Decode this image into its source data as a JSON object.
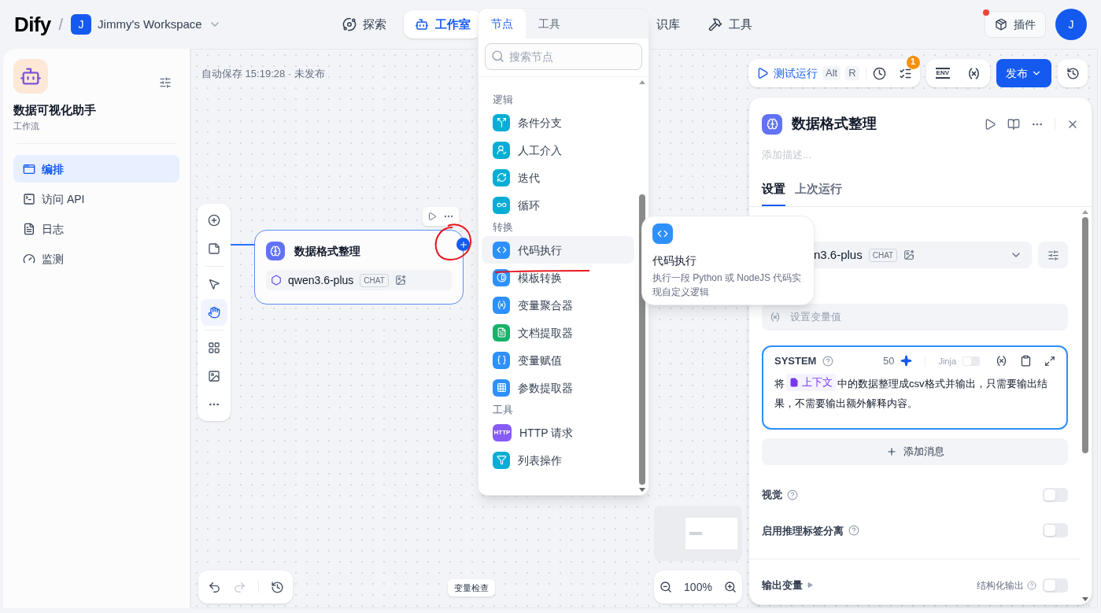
{
  "header": {
    "logo": "Dify",
    "separator": "/",
    "workspace": {
      "initial": "J",
      "name": "Jimmy's Workspace"
    },
    "nav": [
      {
        "label": "探索",
        "selected": false
      },
      {
        "label": "工作室",
        "selected": true
      },
      {
        "label": "识库",
        "selected": false
      },
      {
        "label": "工具",
        "selected": false
      }
    ],
    "plugins": {
      "label": "插件",
      "notification": true
    },
    "avatar": "J"
  },
  "sidebar": {
    "app_name": "数据可视化助手",
    "app_type": "工作流",
    "items": [
      {
        "label": "编排",
        "selected": true
      },
      {
        "label": "访问 API",
        "selected": false
      },
      {
        "label": "日志",
        "selected": false
      },
      {
        "label": "监测",
        "selected": false
      }
    ]
  },
  "canvas": {
    "autosave": "自动保存 15:19:28 · 未发布",
    "node": {
      "title": "数据格式整理",
      "model": "qwen3.6-plus",
      "model_tag": "CHAT"
    },
    "variable_inspect": "变量检查",
    "zoom": "100%"
  },
  "toolbar": {
    "test_run": "测试运行",
    "shortcut_keys": [
      "Alt",
      "R"
    ],
    "checklist_count": "1",
    "env": "ENV",
    "publish": "发布"
  },
  "node_menu": {
    "tabs": [
      {
        "label": "节点",
        "selected": true
      },
      {
        "label": "工具",
        "selected": false
      }
    ],
    "search_placeholder": "搜索节点",
    "groups": [
      {
        "title": "逻辑",
        "items": [
          {
            "label": "条件分支",
            "color": "#06aed4",
            "selected": false
          },
          {
            "label": "人工介入",
            "color": "#06aed4",
            "selected": false
          },
          {
            "label": "迭代",
            "color": "#06aed4",
            "selected": false
          },
          {
            "label": "循环",
            "color": "#06aed4",
            "selected": false
          }
        ]
      },
      {
        "title": "转换",
        "items": [
          {
            "label": "代码执行",
            "color": "#2e90fa",
            "selected": true
          },
          {
            "label": "模板转换",
            "color": "#2e90fa",
            "selected": false
          },
          {
            "label": "变量聚合器",
            "color": "#2e90fa",
            "selected": false
          },
          {
            "label": "文档提取器",
            "color": "#17b26a",
            "selected": false
          },
          {
            "label": "变量赋值",
            "color": "#2e90fa",
            "selected": false
          },
          {
            "label": "参数提取器",
            "color": "#2e90fa",
            "selected": false
          }
        ]
      },
      {
        "title": "工具",
        "items": [
          {
            "label": "HTTP 请求",
            "badge": "HTTP",
            "color": "#875bf7",
            "selected": false
          },
          {
            "label": "列表操作",
            "color": "#06aed4",
            "selected": false
          }
        ]
      }
    ]
  },
  "tooltip": {
    "title": "代码执行",
    "description": "执行一段 Python 或 NodeJS 代码实现自定义逻辑"
  },
  "panel": {
    "title": "数据格式整理",
    "description_placeholder": "添加描述...",
    "tabs": [
      {
        "label": "设置",
        "selected": true
      },
      {
        "label": "上次运行",
        "selected": false
      }
    ],
    "model": "n3.6-plus",
    "model_tag": "CHAT",
    "variable_placeholder": "设置变量值",
    "prompt": {
      "role": "SYSTEM",
      "count": "50",
      "jinja_label": "Jinja",
      "jinja_on": false,
      "text_before": "将",
      "context_chip": "上下文",
      "text_after": "中的数据整理成csv格式并输出，只需要输出结果，不需要输出额外解释内容。"
    },
    "add_message": "添加消息",
    "toggles": [
      {
        "label": "视觉",
        "on": false
      },
      {
        "label": "启用推理标签分离",
        "on": false
      }
    ],
    "output_vars": "输出变量",
    "structured_output": {
      "label": "结构化输出",
      "on": false
    }
  }
}
